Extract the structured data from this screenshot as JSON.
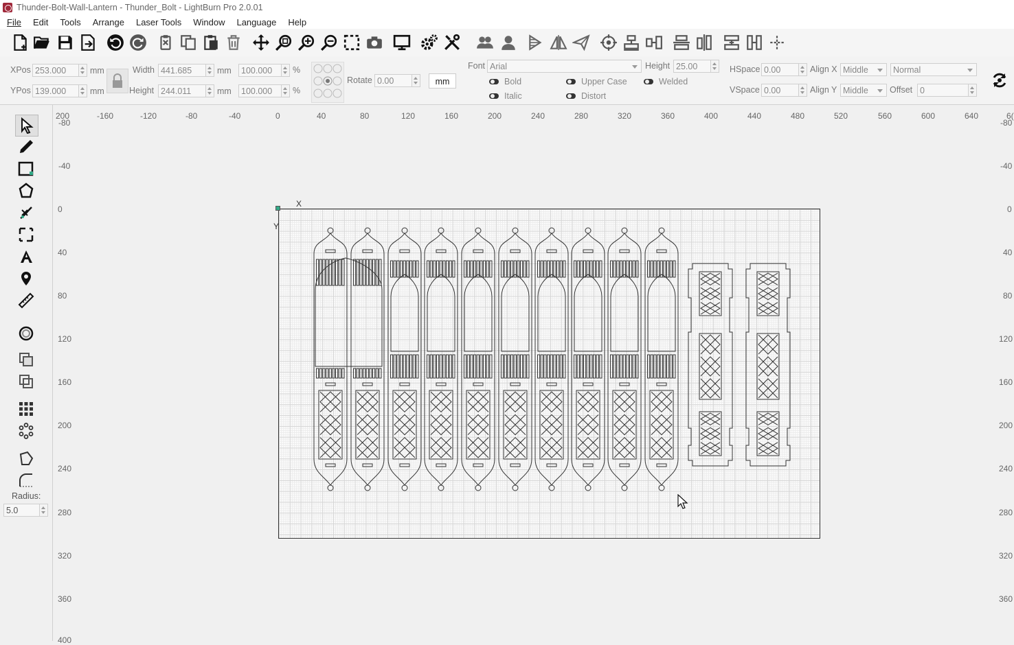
{
  "window": {
    "title": "Thunder-Bolt-Wall-Lantern - Thunder_Bolt - LightBurn Pro 2.0.01"
  },
  "menu": [
    "File",
    "Edit",
    "Tools",
    "Arrange",
    "Laser Tools",
    "Window",
    "Language",
    "Help"
  ],
  "toolbar_icons": [
    "new-file-icon",
    "open-folder-icon",
    "save-icon",
    "import-icon",
    "undo-icon",
    "redo-icon",
    "cut-icon",
    "copy-icon",
    "paste-icon",
    "delete-icon",
    "move-icon",
    "zoom-fit-icon",
    "zoom-in-icon",
    "zoom-out-icon",
    "select-frame-icon",
    "camera-icon",
    "monitor-icon",
    "settings-gears-icon",
    "tools-icon",
    "group-icon",
    "ungroup-icon",
    "mirror-horizontal-icon",
    "mirror-vertical-icon",
    "send-icon",
    "target-icon",
    "align-top-icon",
    "align-middle-icon",
    "distribute-icon",
    "align-center-icon",
    "flip-icon",
    "resize-icon",
    "move-lines-icon"
  ],
  "props": {
    "xpos_label": "XPos",
    "xpos": "253.000",
    "ypos_label": "YPos",
    "ypos": "139.000",
    "unit": "mm",
    "width_label": "Width",
    "width": "441.685",
    "height_label": "Height",
    "height": "244.011",
    "scale_w": "100.000",
    "scale_h": "100.000",
    "pct": "%",
    "rotate_label": "Rotate",
    "rotate": "0.00",
    "mm_button": "mm",
    "font_label": "Font",
    "font": "Arial",
    "text_height_label": "Height",
    "text_height": "25.00",
    "hspace_label": "HSpace",
    "hspace": "0.00",
    "vspace_label": "VSpace",
    "vspace": "0.00",
    "alignx_label": "Align X",
    "alignx": "Middle",
    "aligny_label": "Align Y",
    "aligny": "Middle",
    "mode": "Normal",
    "offset_label": "Offset",
    "offset": "0",
    "bold": "Bold",
    "italic": "Italic",
    "upper_case": "Upper Case",
    "distort": "Distort",
    "welded": "Welded"
  },
  "left_tools": [
    "select-icon",
    "draw-line-icon",
    "rectangle-icon",
    "polygon-icon",
    "edit-nodes-icon",
    "trim-icon",
    "text-icon",
    "position-marker-icon",
    "measure-icon",
    "offset-icon",
    "copy-along-path-icon",
    "boolean-icon",
    "grid-array-icon",
    "circular-array-icon",
    "tab-icon",
    "corner-radius-icon"
  ],
  "radius": {
    "label": "Radius:",
    "value": "5.0"
  },
  "ruler": {
    "x_labels": [
      "200",
      "-160",
      "-120",
      "-80",
      "-40",
      "0",
      "40",
      "80",
      "120",
      "160",
      "200",
      "240",
      "280",
      "320",
      "360",
      "400",
      "440",
      "480",
      "520",
      "560",
      "600",
      "640",
      "6("
    ],
    "y_labels": [
      "-80",
      "-40",
      "0",
      "40",
      "80",
      "120",
      "160",
      "200",
      "240",
      "280",
      "320",
      "360",
      "400"
    ]
  },
  "axis": {
    "x": "X",
    "y": "Y"
  }
}
